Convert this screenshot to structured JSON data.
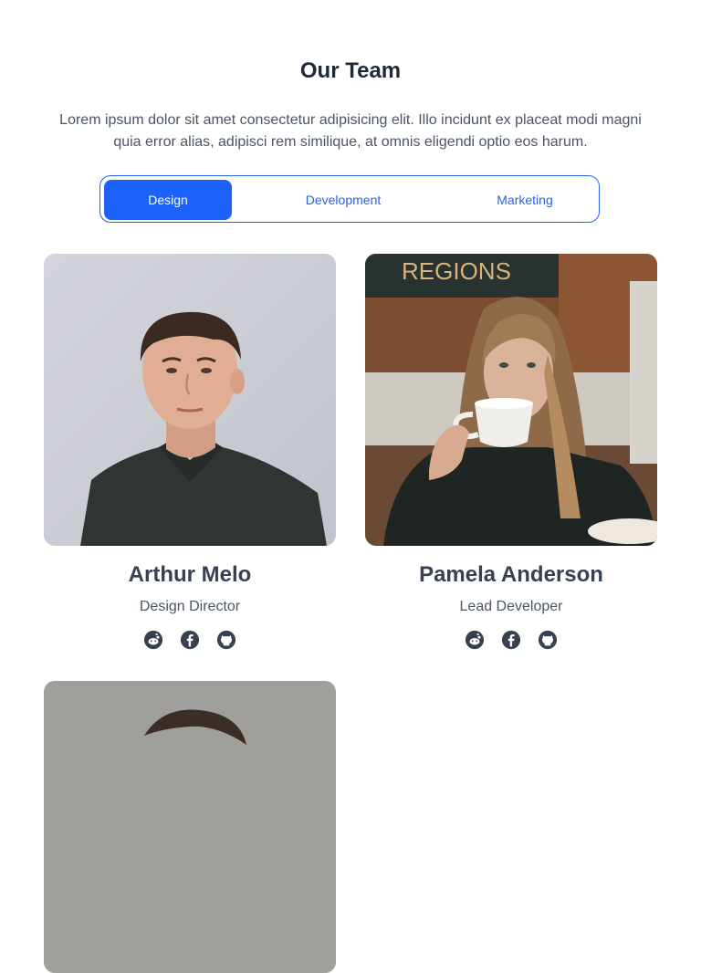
{
  "section": {
    "title": "Our Team",
    "intro": "Lorem ipsum dolor sit amet consectetur adipisicing elit. Illo incidunt ex placeat modi magni quia error alias, adipisci rem similique, at omnis eligendi optio eos harum."
  },
  "tabs": [
    {
      "label": "Design",
      "active": true
    },
    {
      "label": "Development",
      "active": false
    },
    {
      "label": "Marketing",
      "active": false
    }
  ],
  "colors": {
    "accent": "#1d62fb",
    "heading": "#1f2937",
    "muted": "#4b5563"
  },
  "members": [
    {
      "name": "Arthur Melo",
      "role": "Design Director",
      "socials": [
        "reddit-icon",
        "facebook-icon",
        "github-icon"
      ]
    },
    {
      "name": "Pamela Anderson",
      "role": "Lead Developer",
      "socials": [
        "reddit-icon",
        "facebook-icon",
        "github-icon"
      ]
    },
    {
      "name": "",
      "role": "",
      "socials": []
    }
  ],
  "photo_background_sign": "REGIONS"
}
